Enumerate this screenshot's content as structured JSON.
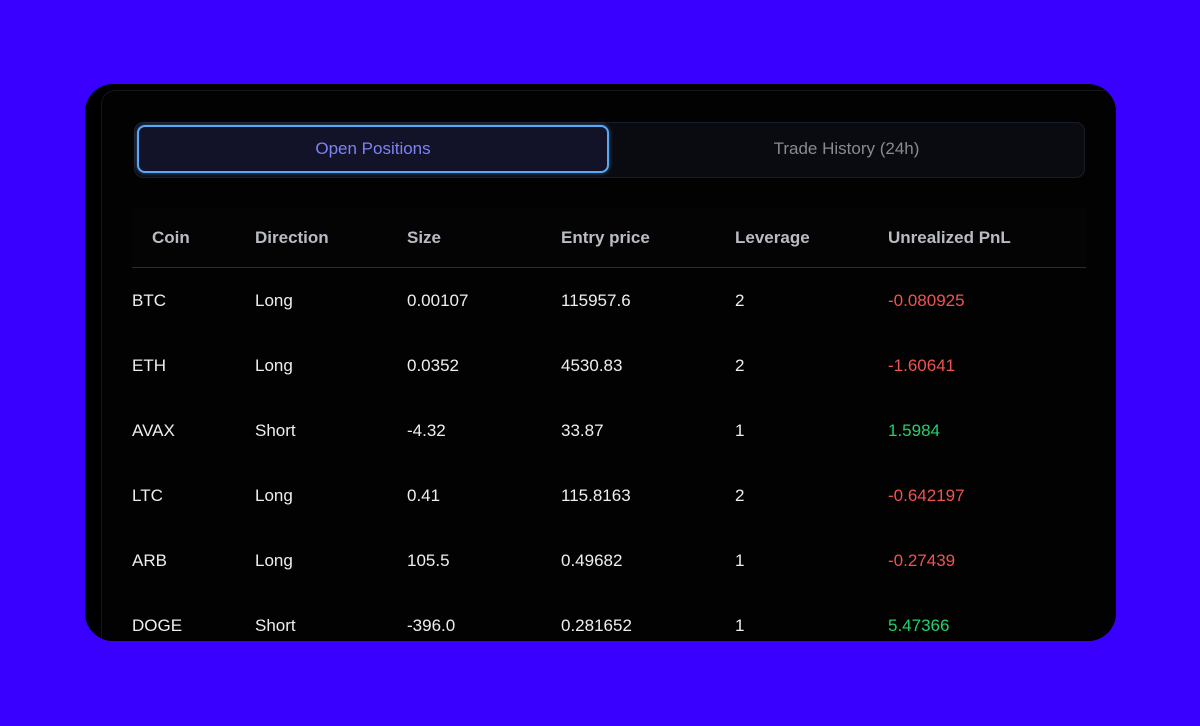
{
  "tabs": [
    {
      "label": "Open Positions",
      "active": true
    },
    {
      "label": "Trade History (24h)",
      "active": false
    }
  ],
  "table": {
    "headers": [
      "Coin",
      "Direction",
      "Size",
      "Entry price",
      "Leverage",
      "Unrealized PnL"
    ],
    "rows": [
      {
        "coin": "BTC",
        "direction": "Long",
        "size": "0.00107",
        "entry_price": "115957.6",
        "leverage": "2",
        "pnl": "-0.080925",
        "pnl_sign": "neg"
      },
      {
        "coin": "ETH",
        "direction": "Long",
        "size": "0.0352",
        "entry_price": "4530.83",
        "leverage": "2",
        "pnl": "-1.60641",
        "pnl_sign": "neg"
      },
      {
        "coin": "AVAX",
        "direction": "Short",
        "size": "-4.32",
        "entry_price": "33.87",
        "leverage": "1",
        "pnl": "1.5984",
        "pnl_sign": "pos"
      },
      {
        "coin": "LTC",
        "direction": "Long",
        "size": "0.41",
        "entry_price": "115.8163",
        "leverage": "2",
        "pnl": "-0.642197",
        "pnl_sign": "neg"
      },
      {
        "coin": "ARB",
        "direction": "Long",
        "size": "105.5",
        "entry_price": "0.49682",
        "leverage": "1",
        "pnl": "-0.27439",
        "pnl_sign": "neg"
      },
      {
        "coin": "DOGE",
        "direction": "Short",
        "size": "-396.0",
        "entry_price": "0.281652",
        "leverage": "1",
        "pnl": "5.47366",
        "pnl_sign": "pos"
      }
    ]
  },
  "colors": {
    "background": "#3a00ff",
    "card": "#000000",
    "active_tab_text": "#7c83f5",
    "active_tab_border": "#5ba8f5",
    "pnl_negative": "#ef5350",
    "pnl_positive": "#21d16a"
  }
}
